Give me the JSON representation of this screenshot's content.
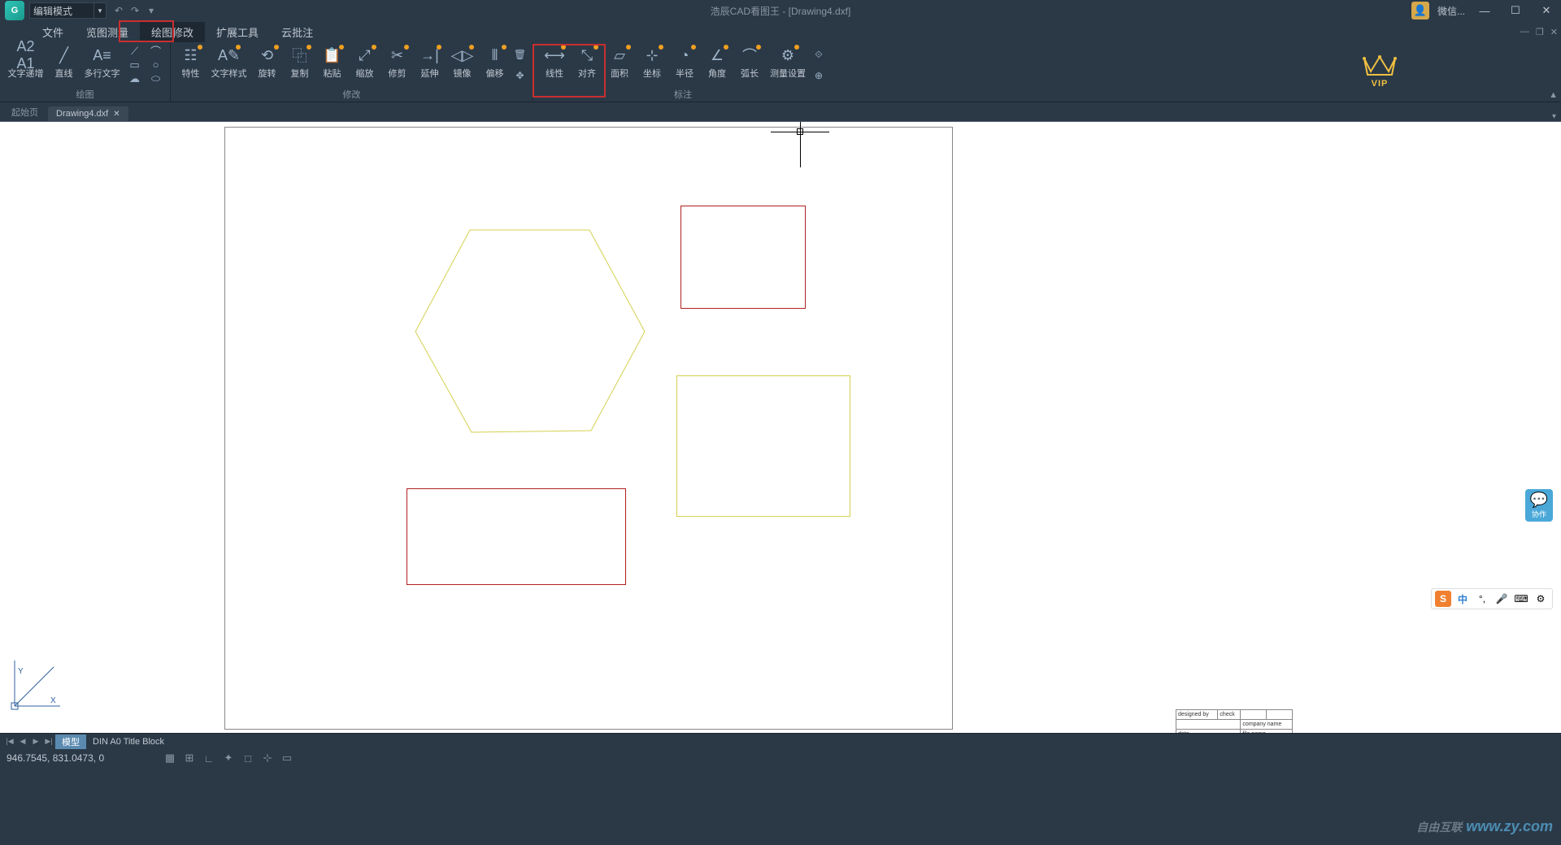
{
  "title": "浩辰CAD看图王 - [Drawing4.dxf]",
  "mode_select": "编辑模式",
  "weixin": "微信...",
  "menus": {
    "file": "文件",
    "view": "览图测量",
    "draw": "绘图修改",
    "ext": "扩展工具",
    "cloud": "云批注"
  },
  "tools_draw": {
    "textinc": "文字递增",
    "line": "直线",
    "mtext": "多行文字"
  },
  "tools_mod": {
    "prop": "特性",
    "textstyle": "文字样式",
    "rotate": "旋转",
    "copy": "复制",
    "paste": "粘贴",
    "scale": "缩放",
    "trim": "修剪",
    "extend": "延伸",
    "mirror": "镜像",
    "offset": "偏移"
  },
  "tools_dim": {
    "linear": "线性",
    "aligned": "对齐",
    "area": "面积",
    "coord": "坐标",
    "radius": "半径",
    "angle": "角度",
    "arc": "弧长",
    "measure": "测量设置"
  },
  "groups": {
    "draw": "绘图",
    "modify": "修改",
    "dim": "标注"
  },
  "vip": "VIP",
  "tabs": {
    "home": "起始页",
    "file": "Drawing4.dxf"
  },
  "layout": {
    "model": "模型",
    "layout1": "DIN A0 Title Block"
  },
  "title_block": {
    "designed": "designed by",
    "check": "check",
    "company": "company name",
    "date": "date",
    "filename": "file name"
  },
  "coords": "946.7545, 831.0473, 0",
  "collab": "协作",
  "ime_ch": "中",
  "watermark": "www.zy.com",
  "watermark_zh": "自由互联"
}
